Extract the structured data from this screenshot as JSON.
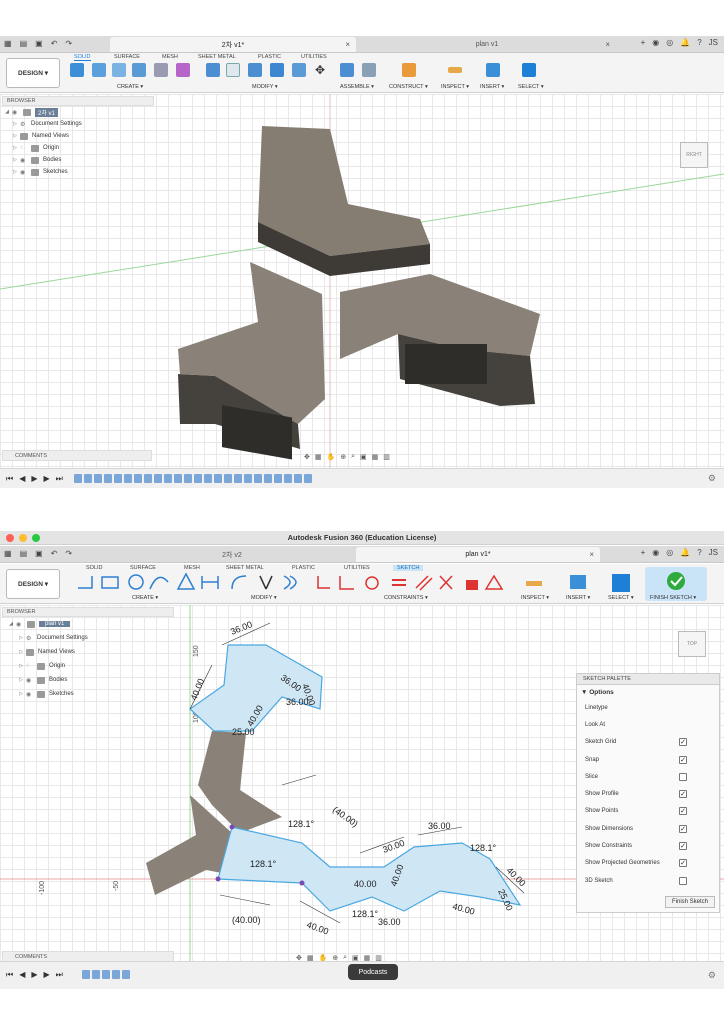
{
  "top": {
    "tabs": [
      {
        "label": "2차 v1*",
        "active": true
      },
      {
        "label": "plan v1",
        "active": false
      }
    ],
    "workspace_tabs": [
      "SOLID",
      "SURFACE",
      "MESH",
      "SHEET METAL",
      "PLASTIC",
      "UTILITIES"
    ],
    "design_label": "DESIGN ▾",
    "groups": [
      "CREATE ▾",
      "MODIFY ▾",
      "ASSEMBLE ▾",
      "CONSTRUCT ▾",
      "INSPECT ▾",
      "INSERT ▾",
      "SELECT ▾"
    ],
    "browser_title": "BROWSER",
    "browser_root": "2차 v1",
    "browser_items": [
      "Document Settings",
      "Named Views",
      "Origin",
      "Bodies",
      "Sketches"
    ],
    "comments": "COMMENTS",
    "viewcube": "RIGHT"
  },
  "bottom": {
    "window_title": "Autodesk Fusion 360 (Education License)",
    "tabs": [
      {
        "label": "2차 v2",
        "active": false
      },
      {
        "label": "plan v1*",
        "active": true
      }
    ],
    "workspace_tabs": [
      "SOLID",
      "SURFACE",
      "MESH",
      "SHEET METAL",
      "PLASTIC",
      "UTILITIES",
      "SKETCH"
    ],
    "design_label": "DESIGN ▾",
    "groups": [
      "CREATE ▾",
      "MODIFY ▾",
      "CONSTRAINTS ▾",
      "INSPECT ▾",
      "INSERT ▾",
      "SELECT ▾",
      "FINISH SKETCH ▾"
    ],
    "browser_title": "BROWSER",
    "browser_root": "plan v1",
    "browser_items": [
      "Document Settings",
      "Named Views",
      "Origin",
      "Bodies",
      "Sketches"
    ],
    "comments": "COMMENTS",
    "viewcube": "TOP",
    "axis_labels": [
      "150",
      "100",
      "-100",
      "-50"
    ],
    "dimensions": [
      "36.00",
      "36.00",
      "40.00",
      "36.00",
      "40.00",
      "25.00",
      "40.00",
      "(40.00)",
      "128.1°",
      "(40.00)",
      "128.1°",
      "40.00",
      "30.00",
      "40.00",
      "36.00",
      "128.1°",
      "40.00",
      "25.00",
      "40.00",
      "128.1°",
      "36.00",
      "40.00"
    ],
    "palette": {
      "title": "SKETCH PALETTE",
      "section": "▼ Options",
      "rows": [
        {
          "label": "Linetype",
          "checked": null
        },
        {
          "label": "Look At",
          "checked": null
        },
        {
          "label": "Sketch Grid",
          "checked": true
        },
        {
          "label": "Snap",
          "checked": true
        },
        {
          "label": "Slice",
          "checked": false
        },
        {
          "label": "Show Profile",
          "checked": true
        },
        {
          "label": "Show Points",
          "checked": true
        },
        {
          "label": "Show Dimensions",
          "checked": true
        },
        {
          "label": "Show Constraints",
          "checked": true
        },
        {
          "label": "Show Projected Geometries",
          "checked": true
        },
        {
          "label": "3D Sketch",
          "checked": false
        }
      ],
      "finish": "Finish Sketch"
    },
    "tooltip": "Podcasts",
    "avatar": "JS"
  },
  "colors": {
    "accent": "#1f7fd8",
    "body": "#8a8278",
    "profile": "#cfe6f5"
  }
}
